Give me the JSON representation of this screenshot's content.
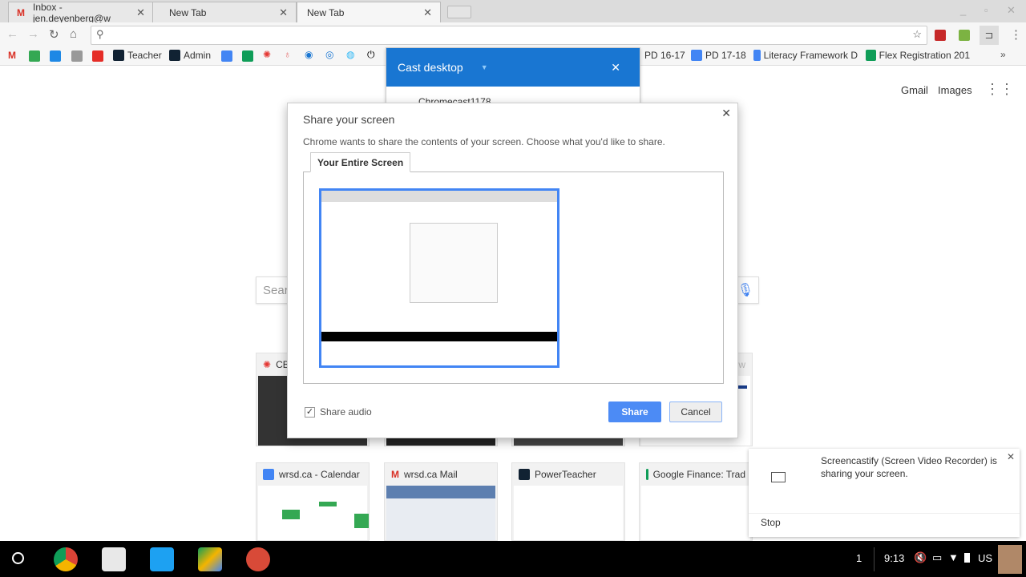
{
  "tabs": [
    {
      "label": "Inbox - jen.deyenberg@w",
      "icon": "gmail-icon"
    },
    {
      "label": "New Tab"
    },
    {
      "label": "New Tab",
      "active": true
    }
  ],
  "omnibox": {
    "value": "",
    "placeholder": ""
  },
  "bookmarks": [
    {
      "label": "Teacher"
    },
    {
      "label": "Admin"
    },
    {
      "label": "PD 16-17"
    },
    {
      "label": "PD 17-18"
    },
    {
      "label": "Literacy Framework D"
    },
    {
      "label": "Flex Registration 201"
    }
  ],
  "ntp": {
    "gmail": "Gmail",
    "images": "Images",
    "search_placeholder": "Sear"
  },
  "cast": {
    "title": "Cast desktop",
    "device": "Chromecast1178"
  },
  "dialog": {
    "title": "Share your screen",
    "description": "Chrome wants to share the contents of your screen. Choose what you'd like to share.",
    "tab": "Your Entire Screen",
    "share_audio": "Share audio",
    "share_audio_checked": true,
    "share": "Share",
    "cancel": "Cancel"
  },
  "tiles_row1": [
    {
      "label": "CB"
    },
    {
      "label": ""
    },
    {
      "label": ""
    },
    {
      "label": "nw"
    }
  ],
  "tiles_row2": [
    {
      "label": "wrsd.ca - Calendar"
    },
    {
      "label": "wrsd.ca Mail"
    },
    {
      "label": "PowerTeacher"
    },
    {
      "label": "Google Finance: Trad"
    }
  ],
  "notification": {
    "message": "Screencastify (Screen Video Recorder) is sharing your screen.",
    "stop": "Stop"
  },
  "tray": {
    "notif_count": "1",
    "time": "9:13",
    "locale": "US"
  },
  "colors": {
    "accent": "#1976d2",
    "share_button": "#4c8bf5"
  }
}
